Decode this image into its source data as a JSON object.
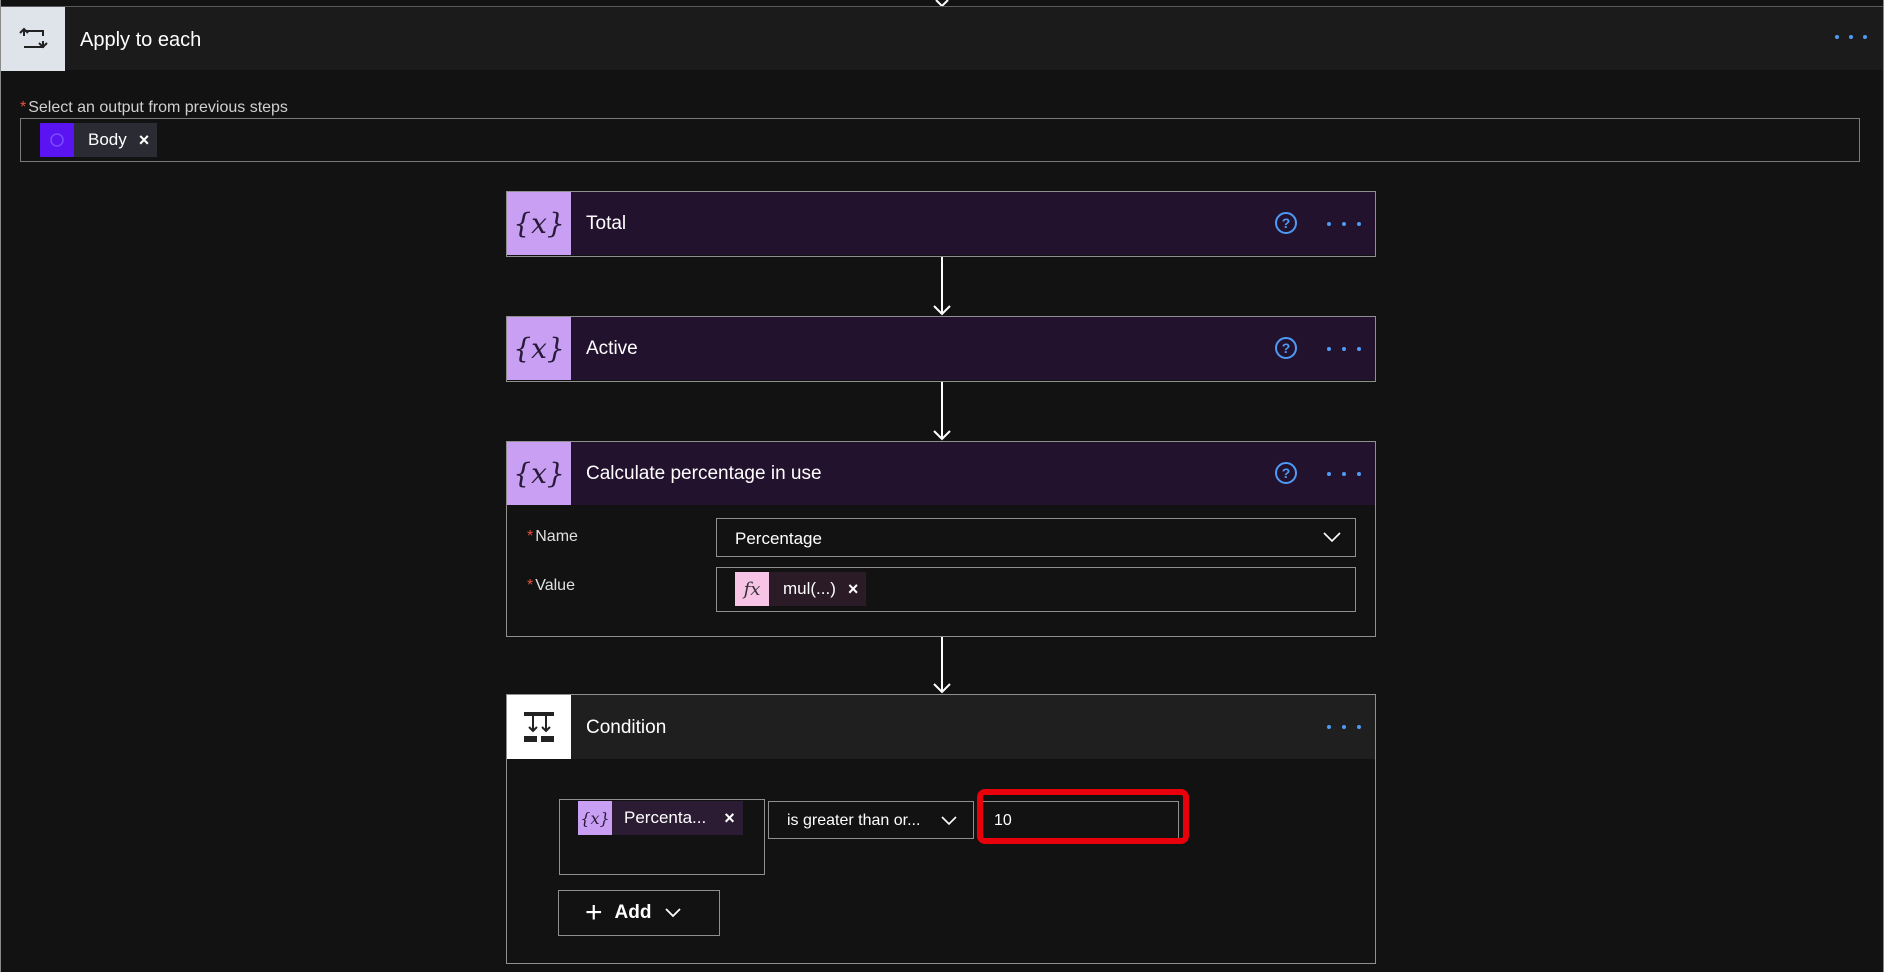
{
  "apply_to_each": {
    "title": "Apply to each",
    "output_label": "Select an output from previous steps",
    "output_token": {
      "label": "Body",
      "close": "×"
    }
  },
  "actions": [
    {
      "title": "Total",
      "help": "?"
    },
    {
      "title": "Active",
      "help": "?"
    },
    {
      "title": "Calculate percentage in use",
      "help": "?",
      "name_label": "Name",
      "name_value": "Percentage",
      "value_label": "Value",
      "value_token": {
        "label": "mul(...)",
        "close": "×",
        "icon_text": "fx"
      }
    }
  ],
  "condition": {
    "title": "Condition",
    "left_token": {
      "label": "Percenta...",
      "close": "×"
    },
    "operator": "is greater than or...",
    "right_value": "10",
    "add_label": "Add"
  },
  "colors": {
    "variable_icon_bg": "#c89ff3",
    "variable_header_bg": "#23122e",
    "accent_blue": "#4e9bf5",
    "highlight_red": "#e8000b",
    "required_red": "#e8513f"
  }
}
